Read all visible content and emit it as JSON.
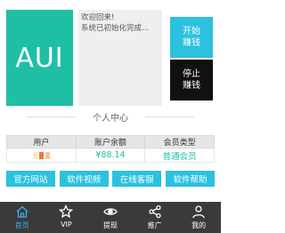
{
  "logo": {
    "text": "AUI"
  },
  "welcome": {
    "line1": "欢迎回来!",
    "line2": "系统已初始化完成..."
  },
  "side_buttons": {
    "start": "开始\n赚钱",
    "stop": "停止\n赚钱"
  },
  "section": {
    "title": "个人中心"
  },
  "table": {
    "headers": [
      "用户",
      "账户余额",
      "会员类型"
    ],
    "balance": "¥88.14",
    "member_type": "普通会员"
  },
  "actions": [
    "官方网站",
    "软件视频",
    "在线客服",
    "软件帮助"
  ],
  "tabs": [
    {
      "label": "首页",
      "icon": "home-icon",
      "active": true
    },
    {
      "label": "VIP",
      "icon": "star-icon",
      "active": false
    },
    {
      "label": "提现",
      "icon": "eye-icon",
      "active": false
    },
    {
      "label": "推广",
      "icon": "share-icon",
      "active": false
    },
    {
      "label": "我的",
      "icon": "user-icon",
      "active": false
    }
  ],
  "colors": {
    "accent": "#2cc1de",
    "logo": "#1fbfa6",
    "tabbar": "#3a3a3a",
    "active_tab": "#3ab0e8",
    "blur": [
      "#f7c49b",
      "#f07a2a",
      "#ffe3cf"
    ]
  }
}
